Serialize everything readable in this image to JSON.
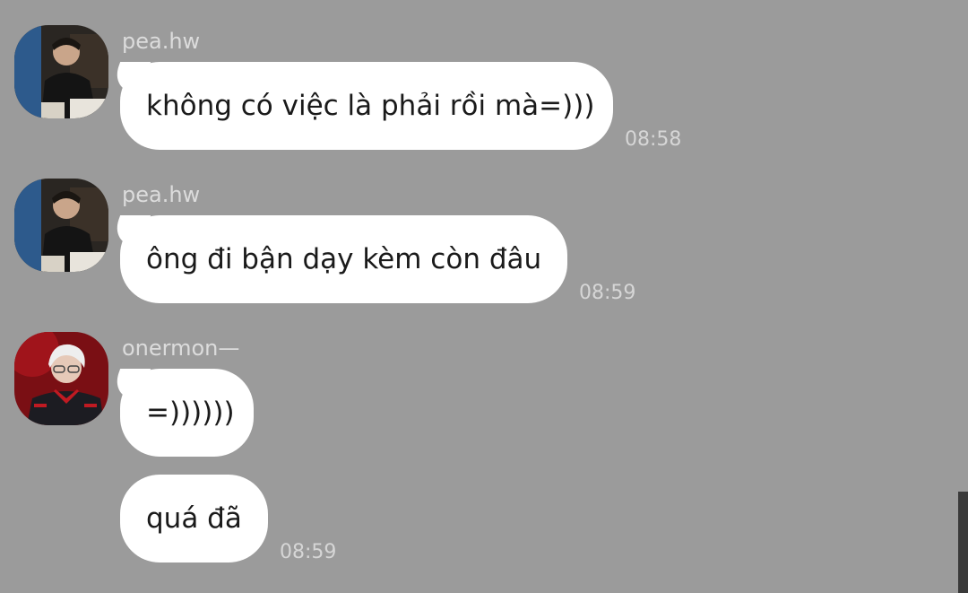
{
  "messages": [
    {
      "sender": "pea.hw",
      "avatar_icon": "profile-photo-dark",
      "text": "không có việc là phải rồi mà=)))",
      "time": "08:58"
    },
    {
      "sender": "pea.hw",
      "avatar_icon": "profile-photo-dark",
      "text": "ông đi bận dạy kèm còn đâu",
      "time": "08:59"
    },
    {
      "sender": "onermon—",
      "avatar_icon": "profile-photo-red",
      "text": "=))))))"
    },
    {
      "text": "quá đã",
      "time": "08:59"
    }
  ],
  "colors": {
    "background": "#9b9b9b",
    "bubble": "#ffffff",
    "sender_text": "#dcdcdc",
    "time_text": "#d6d6d6"
  }
}
